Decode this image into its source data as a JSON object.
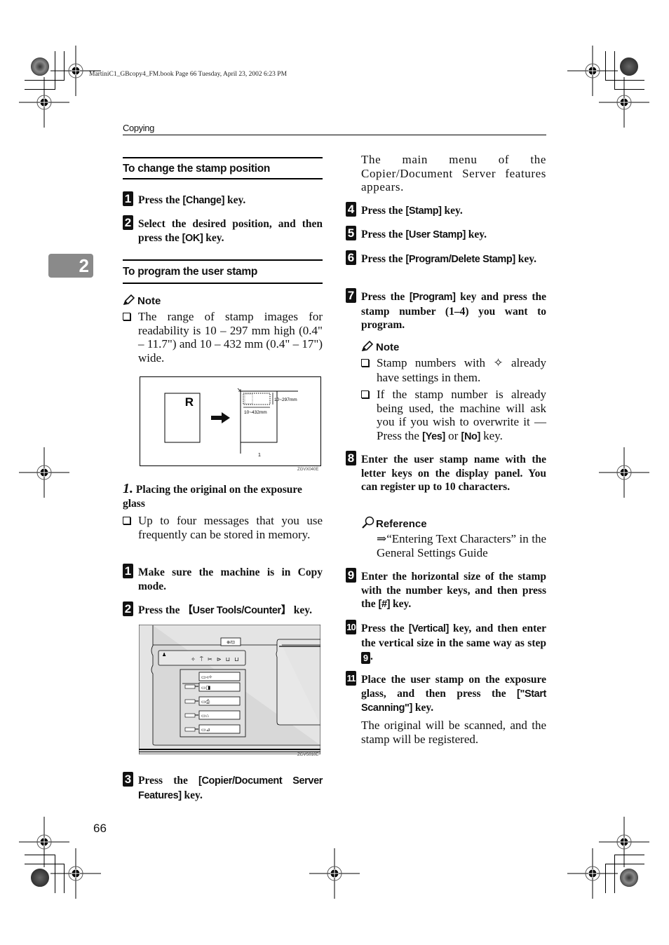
{
  "book_header": "MartiniC1_GBcopy4_FM.book  Page 66  Tuesday, April 23, 2002  6:23 PM",
  "running_head": "Copying",
  "chapter_tab": "2",
  "page_number": "66",
  "left_column": {
    "section1": {
      "title": "To change the stamp position",
      "steps": [
        {
          "num": "1",
          "pre": "Press the ",
          "key": "[Change]",
          "post": " key."
        },
        {
          "num": "2",
          "pre": "Select the desired position, and then press the ",
          "key": "[OK]",
          "post": " key."
        }
      ]
    },
    "section2": {
      "title": "To program the user stamp",
      "note_label": "Note",
      "note_items": [
        "The range of stamp images for readability is 10 – 297 mm high (0.4\" – 11.7\") and 10 – 432 mm (0.4\" – 17\") wide."
      ],
      "figure1": {
        "original_letter": "R",
        "height_label": "10~297mm",
        "width_label": "10~432mm",
        "callout": "1",
        "figure_id": "ZGVX040E"
      },
      "subsection": {
        "number": "1.",
        "title": "Placing the original on the exposure glass",
        "items": [
          "Up to four messages that you use frequently can be stored in memory."
        ]
      },
      "steps": [
        {
          "num": "1",
          "text": "Make sure the machine is in Copy mode."
        },
        {
          "num": "2",
          "pre": "Press the ",
          "key": "【User Tools/Counter】",
          "post": " key."
        }
      ],
      "figure2": {
        "figure_id": "ZGVS010E",
        "top_button_icon": "user-tools-counter-icon"
      },
      "step3": {
        "num": "3",
        "pre": "Press the ",
        "key": "[Copier/Document Server Features]",
        "post": " key."
      }
    }
  },
  "right_column": {
    "intro": "The main menu of the Copier/Document Server features appears.",
    "steps": [
      {
        "num": "4",
        "pre": "Press the ",
        "key": "[Stamp]",
        "post": " key."
      },
      {
        "num": "5",
        "pre": "Press the ",
        "key": "[User Stamp]",
        "post": " key."
      },
      {
        "num": "6",
        "pre": "Press the ",
        "key": "[Program/Delete Stamp]",
        "post": " key."
      },
      {
        "num": "7",
        "pre": "Press the ",
        "key": "[Program]",
        "post": " key and press the stamp number (1–4) you want to program."
      }
    ],
    "note_label": "Note",
    "note_items": [
      {
        "pre": "Stamp numbers with ",
        "icon": "✧",
        "post": " already have settings in them."
      },
      {
        "pre": "If the stamp number is already being used, the machine will ask you if you wish to overwrite it — Press the ",
        "key1": "[Yes]",
        "mid": " or ",
        "key2": "[No]",
        "post": " key."
      }
    ],
    "step8": {
      "num": "8",
      "text": "Enter the user stamp name with the letter keys on the display panel. You can register up to 10 characters."
    },
    "reference_label": "Reference",
    "reference_text": "⇒“Entering Text Characters” in the General Settings Guide",
    "step9": {
      "num": "9",
      "pre": "Enter the horizontal size of the stamp with the number keys, and then press the ",
      "key": "[#]",
      "post": " key."
    },
    "step10": {
      "num": "10",
      "pre": "Press the ",
      "key": "[Vertical]",
      "post": " key, and then enter the vertical size in the same way as step ",
      "ref": "9",
      "end": "."
    },
    "step11": {
      "num": "11",
      "pre": "Place the user stamp on the exposure glass, and then press the ",
      "key": "[\"Start Scanning\"]",
      "post": " key."
    },
    "outro": "The original will be scanned, and the stamp will be registered."
  }
}
